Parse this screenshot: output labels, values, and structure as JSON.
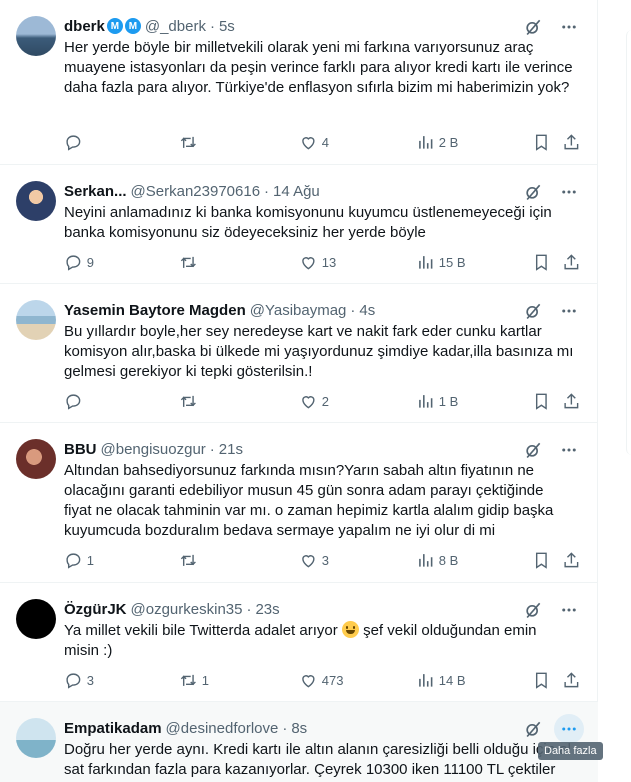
{
  "tweets": [
    {
      "name": "dberk",
      "badges": [
        "M",
        "M"
      ],
      "handle": "@_dberk",
      "time": "5s",
      "text": "Her yerde böyle bir milletvekili olarak yeni mi farkına varıyorsunuz araç muayene istasyonları da peşin verince farklı para alıyor kredi kartı ile verince daha fazla para alıyor. Türkiye'de enflasyon sıfırla bizim mi haberimizin yok?",
      "replies": "",
      "retweets": "",
      "likes": "4",
      "views": "2 B",
      "avatar_color": "#6a8fb0"
    },
    {
      "name": "Serkan...",
      "handle": "@Serkan23970616",
      "time": "14 Ağu",
      "text": "Neyini anlamadınız ki banka komisyonunu kuyumcu üstlenemeyeceği için banka komisyonunu siz ödeyeceksiniz her yerde böyle",
      "replies": "9",
      "retweets": "",
      "likes": "13",
      "views": "15 B",
      "avatar_color": "#4f79b8"
    },
    {
      "name": "Yasemin Baytore Magden",
      "handle": "@Yasibaymag",
      "time": "4s",
      "text": "Bu yıllardır boyle,her sey neredeyse kart ve nakit fark eder cunku kartlar komisyon alır,baska bi ülkede mi yaşıyordunuz şimdiye kadar,illa basınıza mı gelmesi gerekiyor ki tepki gösterilsin.!",
      "replies": "",
      "retweets": "",
      "likes": "2",
      "views": "1 B",
      "avatar_color": "#8fb6cf"
    },
    {
      "name": "BBU",
      "handle": "@bengisuozgur",
      "time": "21s",
      "text": "Altından bahsediyorsunuz farkında mısın?Yarın sabah altın fiyatının ne olacağını garanti edebiliyor musun 45 gün sonra adam parayı çektiğinde fiyat ne olacak tahminin var mı. o zaman hepimiz kartla alalım gidip başka kuyumcuda bozduralım bedava sermaye yapalım ne iyi olur di mi",
      "replies": "1",
      "retweets": "",
      "likes": "3",
      "views": "8 B",
      "avatar_color": "#8a4a3c"
    },
    {
      "name": "ÖzgürJK",
      "handle": "@ozgurkeskin35",
      "time": "23s",
      "text_before_emoji": "Ya millet vekili bile Twitterda adalet arıyor ",
      "text_after_emoji": " şef vekil olduğundan emin misin :)",
      "replies": "3",
      "retweets": "1",
      "likes": "473",
      "views": "14 B",
      "avatar_color": "#000000"
    },
    {
      "name": "Empatikadam",
      "handle": "@desinedforlove",
      "time": "8s",
      "text": "Doğru her yerde aynı. Kredi kartı ile altın alanın çaresizliği belli olduğu için al sat farkından fazla para kazanıyorlar. Çeyrek 10300 iken 11100 TL çektiler",
      "avatar_color": "#7fb3c9"
    }
  ],
  "tooltip": "Daha fazla",
  "icons": {
    "grok": "grok-icon",
    "more": "more-icon",
    "reply": "reply-icon",
    "retweet": "retweet-icon",
    "like": "like-icon",
    "views": "views-icon",
    "bookmark": "bookmark-icon",
    "share": "share-icon"
  },
  "colors": {
    "accent": "#1d9bf0",
    "secondary_text": "#536471",
    "border": "#eff3f4"
  }
}
